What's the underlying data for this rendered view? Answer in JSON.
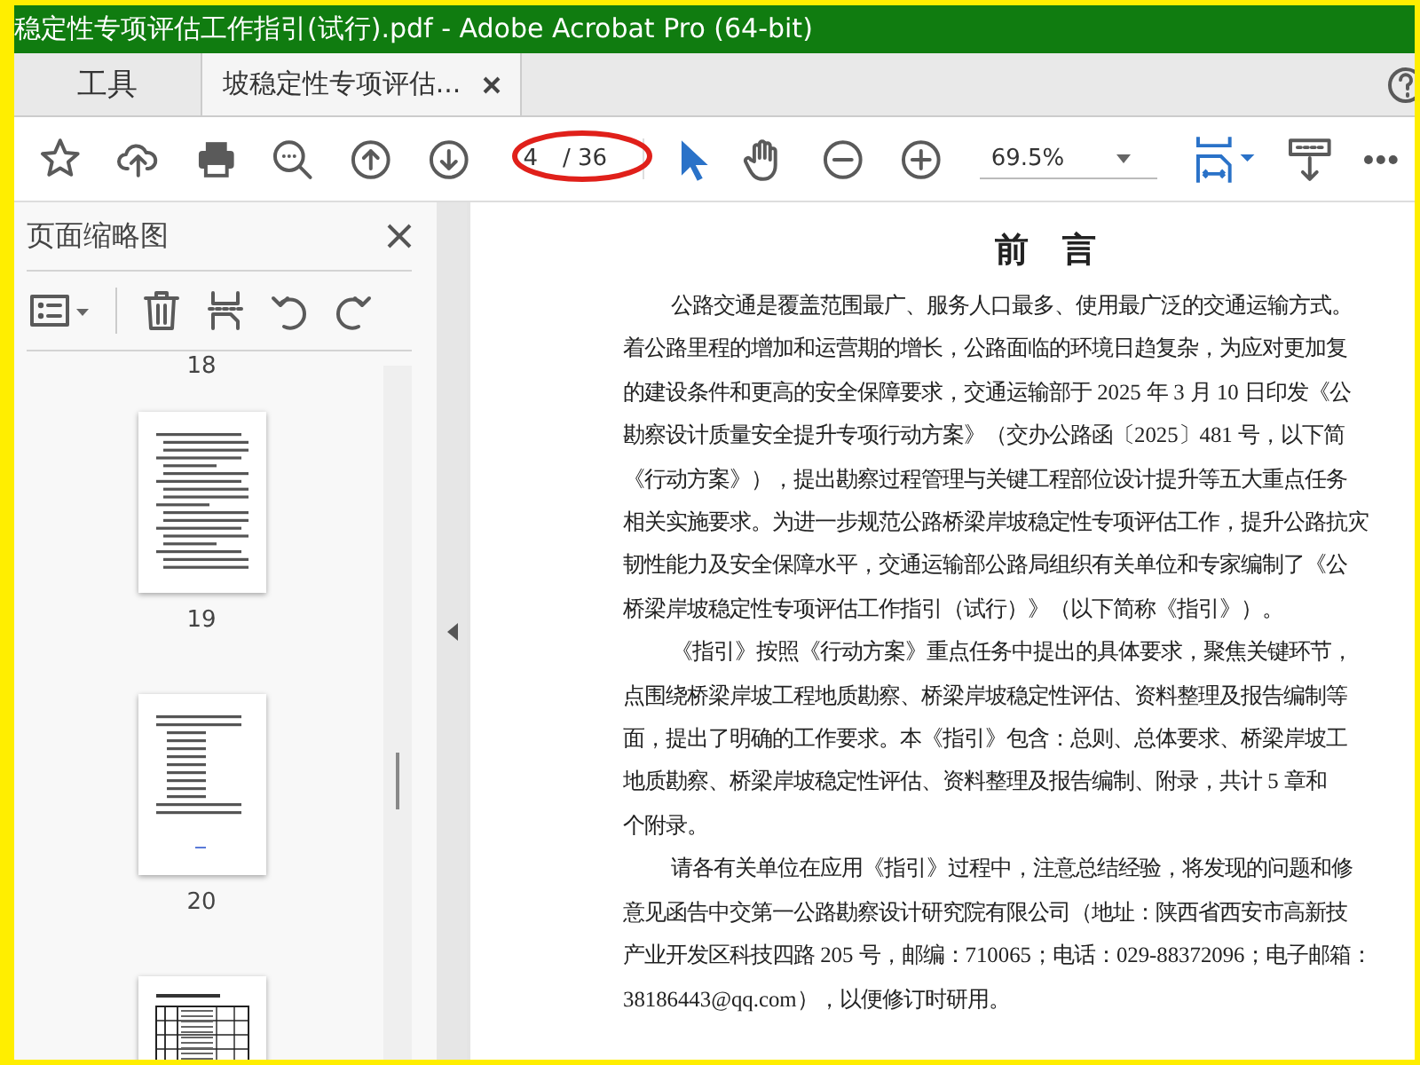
{
  "window": {
    "title": "稳定性专项评估工作指引(试行).pdf - Adobe Acrobat Pro (64-bit)"
  },
  "tabs": [
    {
      "label": "工具",
      "selected": false
    },
    {
      "label": "坡稳定性专项评估...",
      "selected": true
    }
  ],
  "toolbar": {
    "page_number": "4",
    "page_total": "/ 36",
    "zoom": "69.5%"
  },
  "sidebar": {
    "title": "页面缩略图",
    "thumbnails": [
      {
        "label": "18",
        "kind": "cut"
      },
      {
        "label": "19",
        "kind": "text"
      },
      {
        "label": "20",
        "kind": "list"
      },
      {
        "kind": "table"
      }
    ]
  },
  "document": {
    "heading": "前　言",
    "paragraphs": [
      {
        "lines": [
          "公路交通是覆盖范围最广、服务人口最多、使用最广泛的交通运输方式。",
          "着公路里程的增加和运营期的增长，公路面临的环境日趋复杂，为应对更加复",
          "的建设条件和更高的安全保障要求，交通运输部于 2025 年 3 月 10 日印发《公",
          "勘察设计质量安全提升专项行动方案》（交办公路函〔2025〕481 号，以下简",
          "《行动方案》），提出勘察过程管理与关键工程部位设计提升等五大重点任务",
          "相关实施要求。为进一步规范公路桥梁岸坡稳定性专项评估工作，提升公路抗灾",
          "韧性能力及安全保障水平，交通运输部公路局组织有关单位和专家编制了《公",
          "桥梁岸坡稳定性专项评估工作指引（试行）》（以下简称《指引》）。"
        ]
      },
      {
        "lines": [
          "《指引》按照《行动方案》重点任务中提出的具体要求，聚焦关键环节，",
          "点围绕桥梁岸坡工程地质勘察、桥梁岸坡稳定性评估、资料整理及报告编制等",
          "面，提出了明确的工作要求。本《指引》包含：总则、总体要求、桥梁岸坡工",
          "地质勘察、桥梁岸坡稳定性评估、资料整理及报告编制、附录，共计 5 章和",
          "个附录。"
        ]
      },
      {
        "lines": [
          "请各有关单位在应用《指引》过程中，注意总结经验，将发现的问题和修",
          "意见函告中交第一公路勘察设计研究院有限公司（地址：陕西省西安市高新技",
          "产业开发区科技四路 205 号，邮编：710065；电话：029-88372096；电子邮箱：",
          "38186443@qq.com），以便修订时研用。"
        ]
      }
    ]
  }
}
